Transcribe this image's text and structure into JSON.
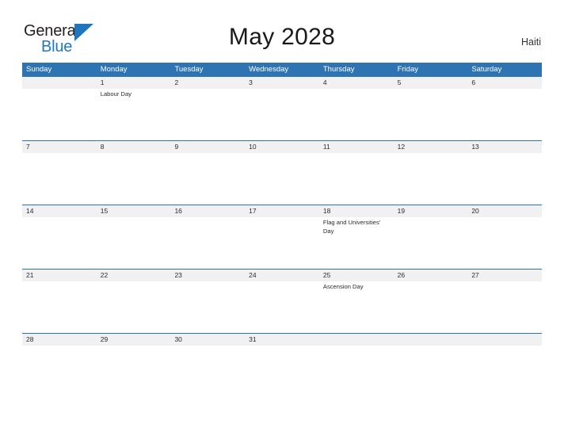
{
  "brand": {
    "name_part1": "General",
    "name_part2": "Blue",
    "triangle_icon": "triangle-icon",
    "accent_color": "#1f76bd",
    "text_color": "#231f20"
  },
  "header": {
    "title": "May 2028",
    "country": "Haiti"
  },
  "theme": {
    "header_blue": "#2e74b3",
    "row_band_gray": "#f1f1f1",
    "text_dark": "#2b2b2b"
  },
  "calendar": {
    "weekdays": [
      "Sunday",
      "Monday",
      "Tuesday",
      "Wednesday",
      "Thursday",
      "Friday",
      "Saturday"
    ],
    "weeks": [
      {
        "days": [
          {
            "number": "",
            "events": []
          },
          {
            "number": "1",
            "events": [
              "Labour Day"
            ]
          },
          {
            "number": "2",
            "events": []
          },
          {
            "number": "3",
            "events": []
          },
          {
            "number": "4",
            "events": []
          },
          {
            "number": "5",
            "events": []
          },
          {
            "number": "6",
            "events": []
          }
        ]
      },
      {
        "days": [
          {
            "number": "7",
            "events": []
          },
          {
            "number": "8",
            "events": []
          },
          {
            "number": "9",
            "events": []
          },
          {
            "number": "10",
            "events": []
          },
          {
            "number": "11",
            "events": []
          },
          {
            "number": "12",
            "events": []
          },
          {
            "number": "13",
            "events": []
          }
        ]
      },
      {
        "days": [
          {
            "number": "14",
            "events": []
          },
          {
            "number": "15",
            "events": []
          },
          {
            "number": "16",
            "events": []
          },
          {
            "number": "17",
            "events": []
          },
          {
            "number": "18",
            "events": [
              "Flag and Universities' Day"
            ]
          },
          {
            "number": "19",
            "events": []
          },
          {
            "number": "20",
            "events": []
          }
        ]
      },
      {
        "days": [
          {
            "number": "21",
            "events": []
          },
          {
            "number": "22",
            "events": []
          },
          {
            "number": "23",
            "events": []
          },
          {
            "number": "24",
            "events": []
          },
          {
            "number": "25",
            "events": [
              "Ascension Day"
            ]
          },
          {
            "number": "26",
            "events": []
          },
          {
            "number": "27",
            "events": []
          }
        ]
      },
      {
        "days": [
          {
            "number": "28",
            "events": []
          },
          {
            "number": "29",
            "events": []
          },
          {
            "number": "30",
            "events": []
          },
          {
            "number": "31",
            "events": []
          },
          {
            "number": "",
            "events": []
          },
          {
            "number": "",
            "events": []
          },
          {
            "number": "",
            "events": []
          }
        ]
      }
    ]
  }
}
